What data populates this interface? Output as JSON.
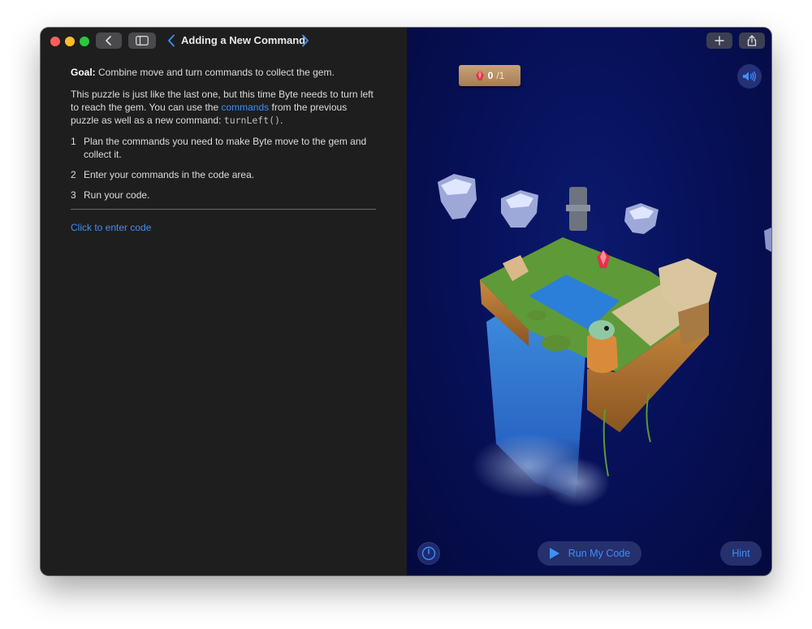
{
  "header": {
    "title": "Adding a New Command"
  },
  "instructions": {
    "goal_label": "Goal:",
    "goal_text": " Combine move and turn commands to collect the gem.",
    "intro_before": "This puzzle is just like the last one, but this time Byte needs to turn left to reach the gem. You can use the ",
    "intro_link": "commands",
    "intro_after": " from the previous puzzle as well as a new command: ",
    "intro_code": "turnLeft()",
    "intro_end": ".",
    "steps": [
      {
        "num": "1",
        "text": "Plan the commands you need to make Byte move to the gem and collect it."
      },
      {
        "num": "2",
        "text": "Enter your commands in the code area."
      },
      {
        "num": "3",
        "text": "Run your code."
      }
    ],
    "enter_code_link": "Click to enter code"
  },
  "game": {
    "gem_count": "0",
    "gem_total": "/1",
    "run_label": "Run My Code",
    "hint_label": "Hint"
  },
  "icons": {
    "back": "chevron-left-icon",
    "sidebar": "sidebar-icon",
    "add": "plus-icon",
    "share": "share-icon",
    "sound": "speaker-icon",
    "speed": "speedometer-icon",
    "run": "play-icon",
    "gem": "gem-icon"
  },
  "colors": {
    "accent": "#3e8ff7",
    "close": "#fe5f57",
    "minimize": "#febc2e",
    "zoom": "#28c840",
    "scene_background": "#07115a"
  }
}
